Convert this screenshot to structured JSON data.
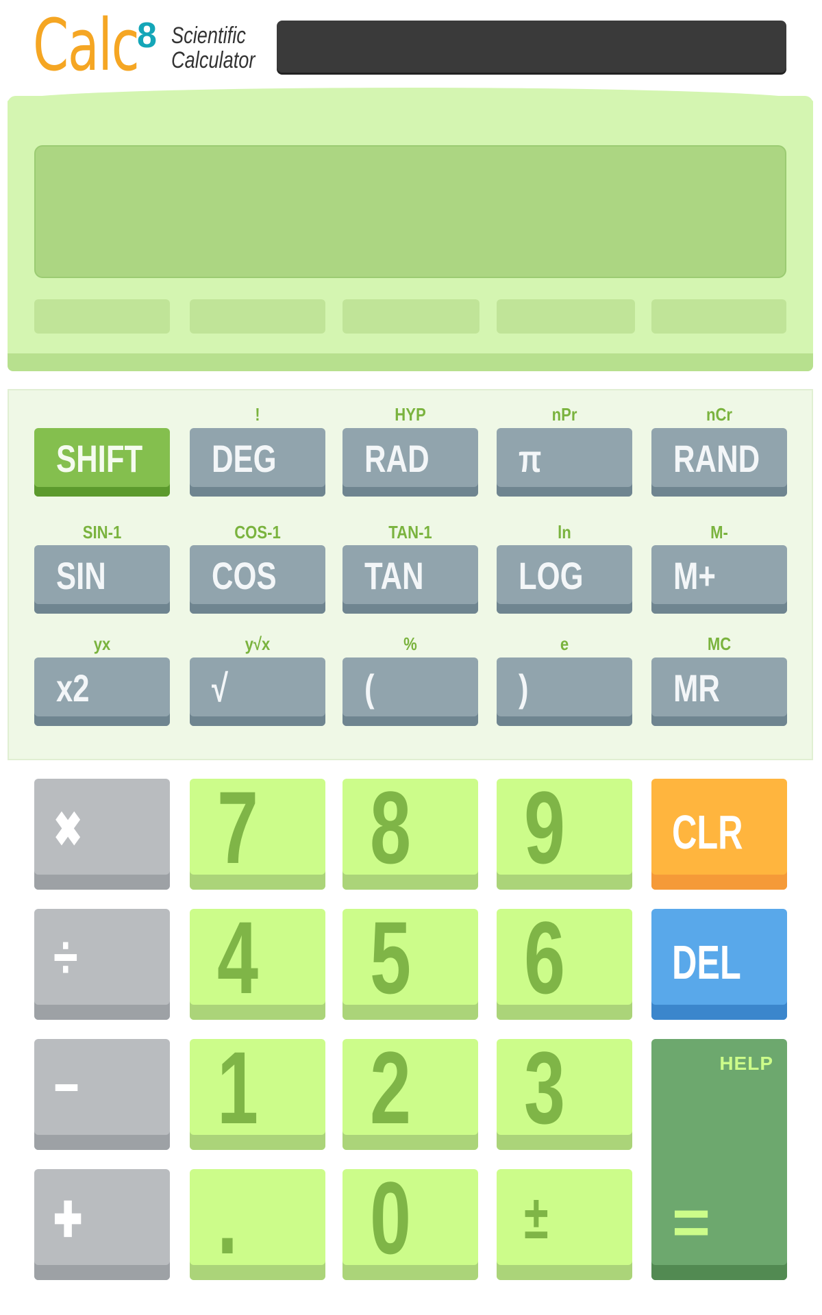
{
  "header": {
    "logo_text": "Calc",
    "logo_sup": "8",
    "subtitle_line1": "Scientific",
    "subtitle_line2": "Calculator"
  },
  "display": {
    "value": ""
  },
  "sci_rows": [
    [
      {
        "primary": "SHIFT",
        "secondary": ""
      },
      {
        "primary": "DEG",
        "secondary": "!"
      },
      {
        "primary": "RAD",
        "secondary": "HYP"
      },
      {
        "primary": "π",
        "secondary": "nPr"
      },
      {
        "primary": "RAND",
        "secondary": "nCr"
      }
    ],
    [
      {
        "primary": "SIN",
        "secondary": "SIN-1"
      },
      {
        "primary": "COS",
        "secondary": "COS-1"
      },
      {
        "primary": "TAN",
        "secondary": "TAN-1"
      },
      {
        "primary": "LOG",
        "secondary": "ln"
      },
      {
        "primary": "M+",
        "secondary": "M-"
      }
    ],
    [
      {
        "primary": "x2",
        "secondary": "yx"
      },
      {
        "primary": "√",
        "secondary": "y√x"
      },
      {
        "primary": "(",
        "secondary": "%"
      },
      {
        "primary": ")",
        "secondary": "e"
      },
      {
        "primary": "MR",
        "secondary": "MC"
      }
    ]
  ],
  "keypad": {
    "multiply": "✖",
    "divide": "÷",
    "minus": "−",
    "plus": "✚",
    "n7": "7",
    "n8": "8",
    "n9": "9",
    "n4": "4",
    "n5": "5",
    "n6": "6",
    "n1": "1",
    "n2": "2",
    "n3": "3",
    "dot": ".",
    "n0": "0",
    "plusminus": "±",
    "clr": "CLR",
    "del": "DEL",
    "help": "HELP",
    "equals": "="
  },
  "colors": {
    "brand_orange": "#f5a623",
    "brand_teal": "#14a6b8",
    "shift_green": "#84bf4e",
    "sci_key": "#91a4ad",
    "number_key": "#ccfc8a",
    "op_key": "#b9bcbf",
    "clear": "#ffb53e",
    "delete": "#59a8ea",
    "equals": "#6da86e"
  }
}
